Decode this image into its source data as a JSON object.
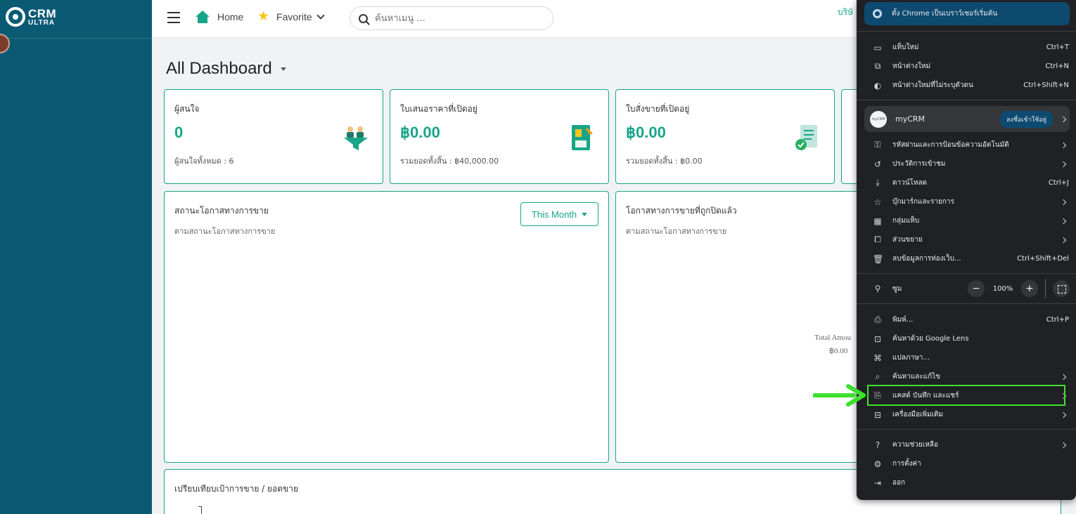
{
  "sidebar": {
    "logo_crm": "CRM",
    "logo_ultra": "ULTRA"
  },
  "topbar": {
    "home": "Home",
    "favorite": "Favorite",
    "search_placeholder": "ค้นหาเมนู ...",
    "company": "บริษั"
  },
  "page_title": "All Dashboard",
  "kpis": [
    {
      "label": "ผู้สนใจ",
      "value": "0",
      "sub": "ผู้สนใจทั้งหมด : 6",
      "icon": "funnel-people-icon"
    },
    {
      "label": "ใบเสนอราคาที่เปิดอยู่",
      "value": "฿0.00",
      "sub": "รวมยอดทั้งสิ้น : ฿40,000.00",
      "icon": "quotation-document-icon"
    },
    {
      "label": "ใบสั่งขายที่เปิดอยู่",
      "value": "฿0.00",
      "sub": "รวมยอดทั้งสิ้น : ฿0.00",
      "icon": "sales-order-check-icon"
    }
  ],
  "panels": {
    "opportunity_status": {
      "title": "สถานะโอกาสทางการขาย",
      "sub": "ตามสถานะโอกาสทางการขาย",
      "filter": "This Month"
    },
    "closed_opportunities": {
      "title": "โอกาสทางการขายที่ถูกปิดแล้ว",
      "sub": "ตามสถานะโอกาสทางการขาย",
      "total_label": "Total Amou",
      "total_value": "฿0.00"
    },
    "target_compare": {
      "title": "เปรียบเทียบเป้าการขาย / ยอดขาย"
    }
  },
  "chrome_menu": {
    "banner": "ตั้ง Chrome เป็นเบราว์เซอร์เริ่มต้น",
    "group1": [
      {
        "icon": "new-tab-icon",
        "label": "แท็บใหม่",
        "shortcut": "Ctrl+T"
      },
      {
        "icon": "new-window-icon",
        "label": "หน้าต่างใหม่",
        "shortcut": "Ctrl+N"
      },
      {
        "icon": "incognito-icon",
        "label": "หน้าต่างใหม่ที่ไม่ระบุตัวตน",
        "shortcut": "Ctrl+Shift+N"
      }
    ],
    "profile": {
      "name": "myCRM",
      "signin": "ลงชื่อเข้าใช้อยู่",
      "avatar": "myCRM"
    },
    "group2": [
      {
        "icon": "key-icon",
        "label": "รหัสผ่านและการป้อนข้อความอัตโนมัติ",
        "shortcut": "",
        "arrow": true
      },
      {
        "icon": "history-icon",
        "label": "ประวัติการเข้าชม",
        "shortcut": "",
        "arrow": true
      },
      {
        "icon": "download-icon",
        "label": "ดาวน์โหลด",
        "shortcut": "Ctrl+J",
        "arrow": false
      },
      {
        "icon": "bookmark-star-icon",
        "label": "บุ๊กมาร์กและรายการ",
        "shortcut": "",
        "arrow": true
      },
      {
        "icon": "tab-groups-icon",
        "label": "กลุ่มแท็บ",
        "shortcut": "",
        "arrow": true
      },
      {
        "icon": "extension-icon",
        "label": "ส่วนขยาย",
        "shortcut": "",
        "arrow": true
      },
      {
        "icon": "trash-icon",
        "label": "ลบข้อมูลการท่องเว็บ...",
        "shortcut": "Ctrl+Shift+Del",
        "arrow": false
      }
    ],
    "zoom": {
      "label": "ซูม",
      "minus": "−",
      "value": "100%",
      "plus": "+"
    },
    "group3": [
      {
        "icon": "print-icon",
        "label": "พิมพ์...",
        "shortcut": "Ctrl+P",
        "arrow": false
      },
      {
        "icon": "google-lens-icon",
        "label": "ค้นหาด้วย Google Lens",
        "shortcut": "",
        "arrow": false
      },
      {
        "icon": "translate-icon",
        "label": "แปลภาษา...",
        "shortcut": "",
        "arrow": false
      },
      {
        "icon": "find-edit-icon",
        "label": "ค้นหาและแก้ไข",
        "shortcut": "",
        "arrow": true
      },
      {
        "icon": "cast-save-share-icon",
        "label": "แคสต์ บันทึก และแชร์",
        "shortcut": "",
        "arrow": true
      },
      {
        "icon": "more-tools-icon",
        "label": "เครื่องมือเพิ่มเติม",
        "shortcut": "",
        "arrow": true
      }
    ],
    "group4": [
      {
        "icon": "help-icon",
        "label": "ความช่วยเหลือ",
        "shortcut": "",
        "arrow": true
      },
      {
        "icon": "settings-gear-icon",
        "label": "การตั้งค่า",
        "shortcut": "",
        "arrow": false
      },
      {
        "icon": "exit-icon",
        "label": "ออก",
        "shortcut": "",
        "arrow": false
      }
    ]
  },
  "colors": {
    "sidebar": "#0b5a74",
    "accent": "#17a589",
    "highlight": "#3de02c",
    "menu_bg": "#202124"
  }
}
